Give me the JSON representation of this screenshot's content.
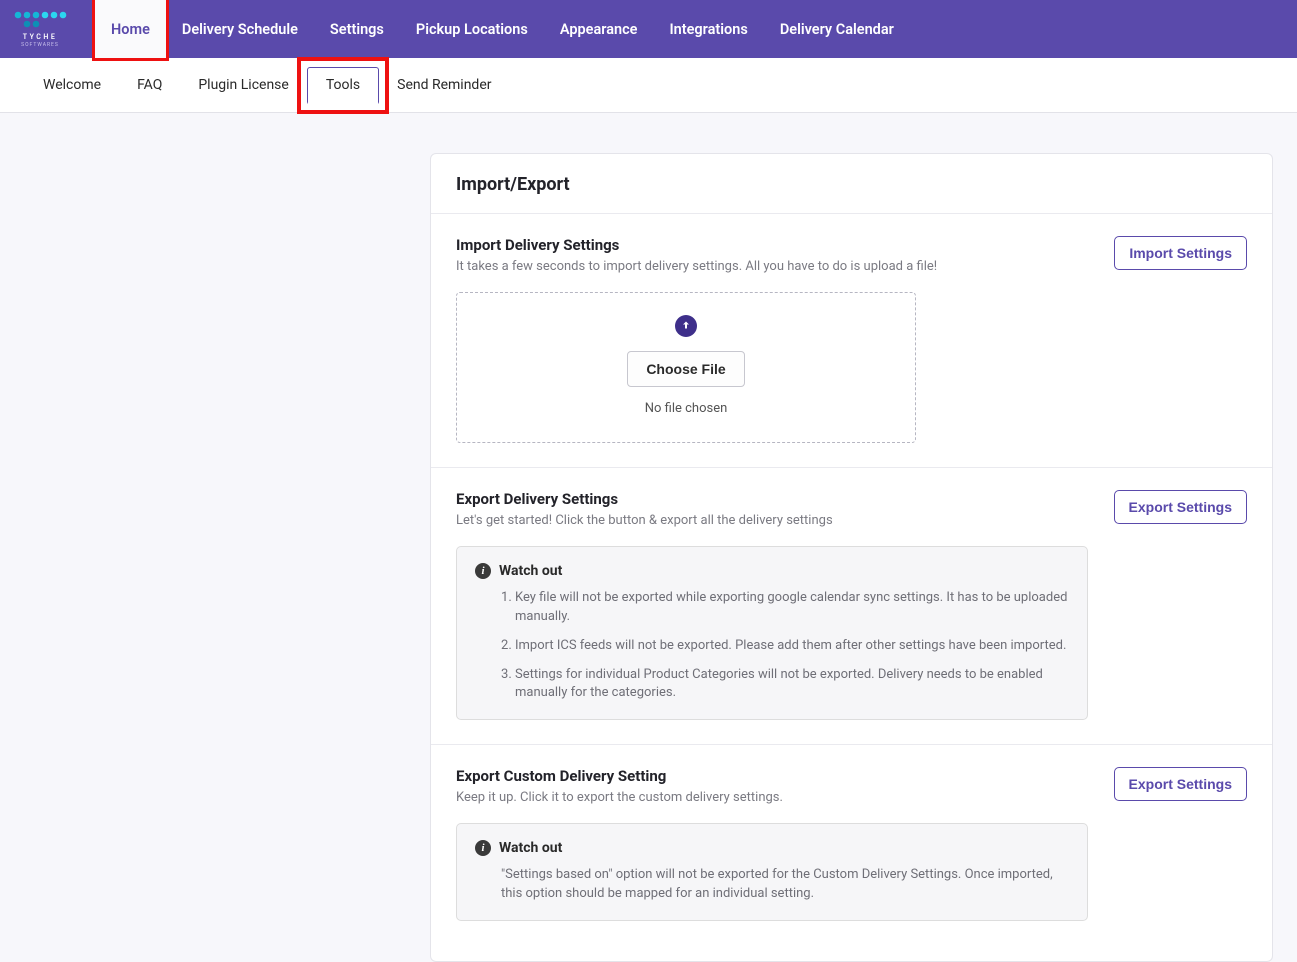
{
  "brand": {
    "name": "TYCHE",
    "sub": "SOFTWARES"
  },
  "primaryNav": {
    "items": [
      "Home",
      "Delivery Schedule",
      "Settings",
      "Pickup Locations",
      "Appearance",
      "Integrations",
      "Delivery Calendar"
    ],
    "activeIndex": 0
  },
  "subNav": {
    "items": [
      "Welcome",
      "FAQ",
      "Plugin License",
      "Tools",
      "Send Reminder"
    ],
    "activeIndex": 3
  },
  "page": {
    "title": "Import/Export"
  },
  "importSection": {
    "title": "Import Delivery Settings",
    "desc": "It takes a few seconds to import delivery settings. All you have to do is upload a file!",
    "button": "Import Settings",
    "chooseFile": "Choose File",
    "noFile": "No file chosen"
  },
  "exportSection": {
    "title": "Export Delivery Settings",
    "desc": "Let's get started! Click the button & export all the delivery settings",
    "button": "Export Settings",
    "watchTitle": "Watch out",
    "watchItems": [
      "Key file will not be exported while exporting google calendar sync settings. It has to be uploaded manually.",
      "Import ICS feeds will not be exported. Please add them after other settings have been imported.",
      "Settings for individual Product Categories will not be exported. Delivery needs to be enabled manually for the categories."
    ]
  },
  "exportCustomSection": {
    "title": "Export Custom Delivery Setting",
    "desc": "Keep it up. Click it to export the custom delivery settings.",
    "button": "Export Settings",
    "watchTitle": "Watch out",
    "watchText": "\"Settings based on\" option will not be exported for the Custom Delivery Settings. Once imported, this option should be mapped for an individual setting."
  }
}
